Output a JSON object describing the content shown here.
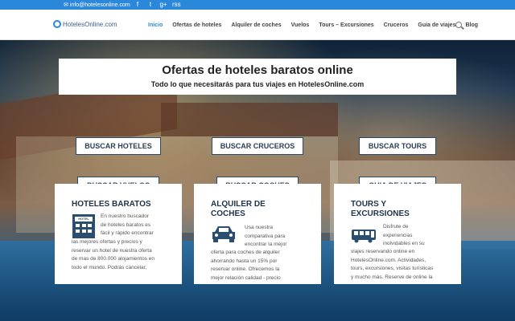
{
  "topbar": {
    "email": "info@hotelesonline.com",
    "social": [
      "f",
      "t",
      "g+",
      "rss"
    ]
  },
  "header": {
    "logo_text": "HotelesOnline.com",
    "nav": [
      {
        "label": "Inicio",
        "active": true
      },
      {
        "label": "Ofertas de hoteles",
        "active": false
      },
      {
        "label": "Alquiler de coches",
        "active": false
      },
      {
        "label": "Vuelos",
        "active": false
      },
      {
        "label": "Tours – Excursiones",
        "active": false
      },
      {
        "label": "Cruceros",
        "active": false
      },
      {
        "label": "Guia de viajes",
        "active": false
      },
      {
        "label": "Blog",
        "active": false
      }
    ]
  },
  "hero": {
    "title": "Ofertas de hoteles baratos online",
    "subtitle": "Todo lo que necesitarás para tus viajes en HotelesOnline.com",
    "buttons": {
      "hoteles": "BUSCAR HOTELES",
      "cruceros": "BUSCAR CRUCEROS",
      "tours": "BUSCAR TOURS",
      "vuelos": "BUSCAR VUELOS",
      "coches": "BUSCAR COCHES",
      "guia": "GUIA DE VIAJES"
    }
  },
  "cards": {
    "hoteles": {
      "title": "HOTELES BARATOS",
      "icon_label": "HOTEL",
      "text_lines": [
        "En nuestro buscador",
        "de hoteles baratos es",
        "fácil y rápido encontrar"
      ],
      "text_full": [
        "las mejores ofertas y precios y",
        "reservar un hotel de nuestra oferta",
        "de mas de 800.000 alojamientos en",
        "todo el mundo. Podrás cancelar,"
      ]
    },
    "coches": {
      "title_1": "ALQUILER DE",
      "title_2": "COCHES",
      "text_lines": [
        "Usa nuestra",
        "comparativa para",
        "encontrar la mejor",
        "oferta para coches de alquiler",
        "ahorrando hasta un 15% por",
        "reservar online. Ofrecemos la",
        "mejor relación calidad - precio"
      ]
    },
    "tours": {
      "title_1": "TOURS Y",
      "title_2": "EXCURSIONES",
      "text_lines": [
        "Disfrute de",
        "experiencias",
        "inolvidables en su"
      ],
      "text_full": [
        "viajes reservando online en",
        "HotelesOnline.com. Actividades,",
        "tours, excursiones, visitas turísticas",
        "y mucho más. Reserve de online la"
      ]
    }
  },
  "colors": {
    "topbar": "#2b87da",
    "accent": "#2b87da",
    "card_title": "#1f3347",
    "icon": "#2b4e70"
  }
}
